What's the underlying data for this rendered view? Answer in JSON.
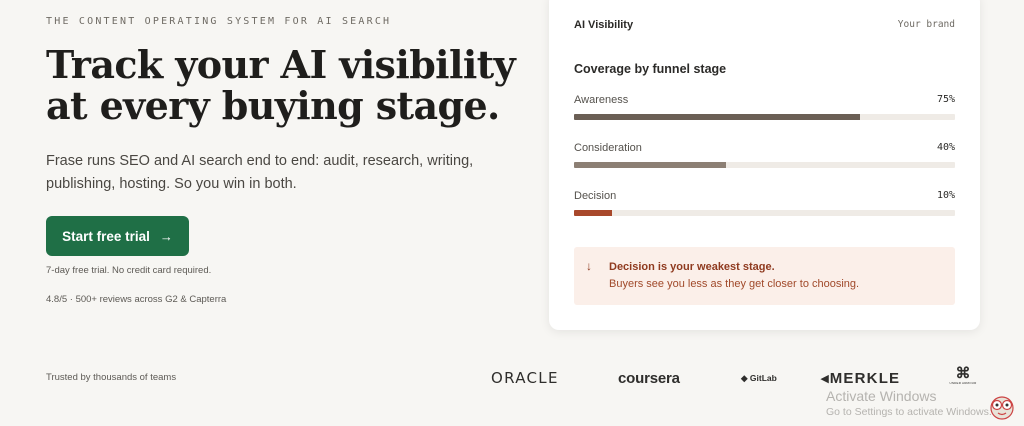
{
  "hero": {
    "eyebrow": "THE CONTENT OPERATING SYSTEM FOR AI SEARCH",
    "headline_line1": "Track your AI visibility",
    "headline_line2": "at every buying stage.",
    "subtitle_line1": "Frase runs SEO and AI search end to end: audit, research, writing,",
    "subtitle_line2": "publishing, hosting. So you win in both.",
    "cta_label": "Start free trial",
    "cta_arrow": "→",
    "trial_note": "7-day free trial. No credit card required.",
    "reviews": "4.8/5 · 500+ reviews across G2 & Capterra"
  },
  "card": {
    "title": "AI Visibility",
    "brand": "Your brand",
    "section_title": "Coverage by funnel stage",
    "stages": [
      {
        "label": "Awareness",
        "percent_text": "75%",
        "value": 0.75,
        "color": "#6b5f55"
      },
      {
        "label": "Consideration",
        "percent_text": "40%",
        "value": 0.4,
        "color": "#8c7f74"
      },
      {
        "label": "Decision",
        "percent_text": "10%",
        "value": 0.1,
        "color": "#a8482b"
      }
    ],
    "alert": {
      "icon": "arrow-down-icon",
      "title": "Decision is your weakest stage.",
      "body": "Buyers see you less as they get closer to choosing."
    }
  },
  "footer": {
    "trusted": "Trusted by thousands of teams",
    "logos": [
      "ORACLE",
      "coursera",
      "GitLab",
      "MERKLE",
      "UNDER ARMOUR"
    ]
  },
  "windows": {
    "activate_title": "Activate Windows",
    "activate_sub": "Go to Settings to activate Windows."
  },
  "colors": {
    "accent": "#1f6f46",
    "alert_bg": "#fbefe9",
    "alert_text": "#8f3a1f"
  }
}
